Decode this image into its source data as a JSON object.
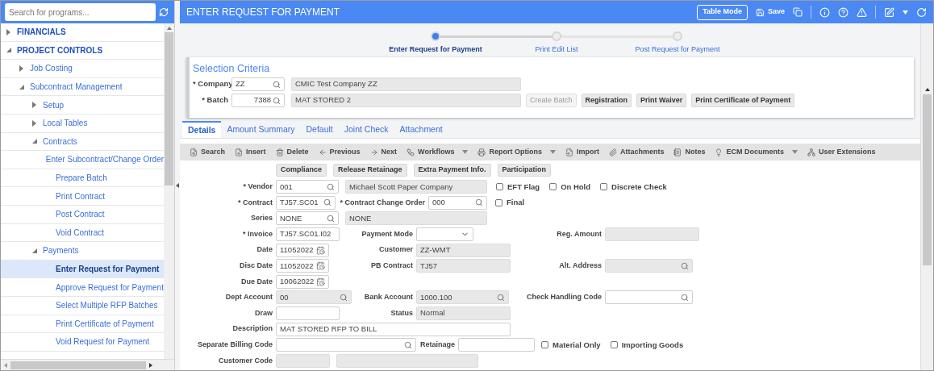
{
  "sidebar": {
    "search": {
      "placeholder": "Search for programs..."
    },
    "tree": [
      {
        "label": "FINANCIALS",
        "expanded": false,
        "selected": false
      },
      {
        "label": "PROJECT CONTROLS",
        "expanded": true,
        "selected": false,
        "children": [
          {
            "label": "Job Costing",
            "expanded": false,
            "selected": false
          },
          {
            "label": "Subcontract Management",
            "expanded": true,
            "selected": false,
            "children": [
              {
                "label": "Setup",
                "expanded": false,
                "selected": false
              },
              {
                "label": "Local Tables",
                "expanded": false,
                "selected": false
              },
              {
                "label": "Contracts",
                "expanded": true,
                "selected": false,
                "children": [
                  {
                    "label": "Enter Subcontract/Change Order",
                    "selected": false
                  },
                  {
                    "label": "Prepare Batch",
                    "selected": false
                  },
                  {
                    "label": "Print Contract",
                    "selected": false
                  },
                  {
                    "label": "Post Contract",
                    "selected": false
                  },
                  {
                    "label": "Void Contract",
                    "selected": false
                  }
                ]
              },
              {
                "label": "Payments",
                "expanded": true,
                "selected": false,
                "children": [
                  {
                    "label": "Enter Request for Payment",
                    "selected": true
                  },
                  {
                    "label": "Approve Request for Payment",
                    "selected": false
                  },
                  {
                    "label": "Select Multiple RFP Batches",
                    "selected": false
                  },
                  {
                    "label": "Print Certificate of Payment",
                    "selected": false
                  },
                  {
                    "label": "Void Request for Payment",
                    "selected": false
                  }
                ]
              }
            ]
          }
        ]
      }
    ]
  },
  "header": {
    "title": "ENTER REQUEST FOR PAYMENT",
    "table_mode_button": "Table Mode",
    "save_button": "Save"
  },
  "steps": [
    {
      "label": "Enter Request for Payment",
      "selected": true
    },
    {
      "label": "Print Edit List",
      "selected": false
    },
    {
      "label": "Post Request for Payment",
      "selected": false
    }
  ],
  "selection_criteria": {
    "title": "Selection Criteria",
    "rows": [
      {
        "label": "* Company",
        "value": "ZZ",
        "name": "CMIC Test Company ZZ",
        "buttons": []
      },
      {
        "label": "* Batch",
        "value": "7388",
        "name": "MAT STORED 2",
        "buttons": [
          {
            "label": "Create Batch",
            "disabled": true
          },
          {
            "label": "Registration",
            "disabled": false
          },
          {
            "label": "Print Waiver",
            "disabled": false
          },
          {
            "label": "Print Certificate of Payment",
            "disabled": false
          }
        ]
      }
    ]
  },
  "tabs": [
    {
      "label": "Details",
      "selected": true
    },
    {
      "label": "Amount Summary",
      "selected": false
    },
    {
      "label": "Default",
      "selected": false
    },
    {
      "label": "Joint Check",
      "selected": false
    },
    {
      "label": "Attachment",
      "selected": false
    }
  ],
  "toolbar": [
    {
      "label": "Search",
      "dropdown": false
    },
    {
      "label": "Insert",
      "dropdown": false
    },
    {
      "label": "Delete",
      "dropdown": false
    },
    {
      "label": "Previous",
      "dropdown": false
    },
    {
      "label": "Next",
      "dropdown": false
    },
    {
      "label": "Workflows",
      "dropdown": true
    },
    {
      "label": "Report Options",
      "dropdown": true
    },
    {
      "label": "Import",
      "dropdown": false
    },
    {
      "label": "Attachments",
      "dropdown": false
    },
    {
      "label": "Notes",
      "dropdown": false
    },
    {
      "label": "ECM Documents",
      "dropdown": true
    },
    {
      "label": "User Extensions",
      "dropdown": false
    }
  ],
  "action_buttons": [
    "Compliance",
    "Release Retainage",
    "Extra Payment Info.",
    "Participation"
  ],
  "form_rows": [
    [
      {
        "kind": "lookup",
        "label": "* Vendor",
        "value": "001",
        "readonly": false
      },
      {
        "kind": "text",
        "value": "Michael Scott Paper Company",
        "readonly": true
      },
      {
        "kind": "checkbox",
        "label": "EFT Flag",
        "checked": false
      },
      {
        "kind": "checkbox",
        "label": "On Hold",
        "checked": false
      },
      {
        "kind": "checkbox",
        "label": "Discrete Check",
        "checked": false
      }
    ],
    [
      {
        "kind": "lookup",
        "label": "* Contract",
        "value": "TJ57.SC01",
        "readonly": false
      },
      {
        "kind": "lookup",
        "label": "* Contract Change Order",
        "value": "000",
        "readonly": false
      },
      {
        "kind": "checkbox",
        "label": "Final",
        "checked": false
      }
    ],
    [
      {
        "kind": "lookup",
        "label": "Series",
        "value": "NONE",
        "readonly": false
      },
      {
        "kind": "text",
        "value": "NONE",
        "readonly": true
      }
    ],
    [
      {
        "kind": "text",
        "label": "* Invoice",
        "value": "TJ57.SC01.I02",
        "readonly": false
      },
      {
        "kind": "select",
        "label": "Payment Mode",
        "readonly": false
      },
      {
        "kind": "text",
        "label": "Reg. Amount",
        "readonly": true
      }
    ],
    [
      {
        "kind": "date",
        "label": "Date",
        "value": "11052022",
        "readonly": false
      },
      {
        "kind": "text",
        "label": "Customer",
        "value": "ZZ-WMT",
        "readonly": true
      }
    ],
    [
      {
        "kind": "date",
        "label": "Disc Date",
        "value": "11052022",
        "readonly": false
      },
      {
        "kind": "text",
        "label": "PB Contract",
        "value": "TJ57",
        "readonly": true
      },
      {
        "kind": "lookup",
        "label": "Alt. Address",
        "readonly": true
      }
    ],
    [
      {
        "kind": "date",
        "label": "Due Date",
        "value": "10062022",
        "readonly": false
      }
    ],
    [
      {
        "kind": "lookup",
        "label": "Dept Account",
        "value": "00",
        "readonly": true
      },
      {
        "kind": "lookup",
        "label": "Bank Account",
        "value": "1000.100",
        "readonly": true
      },
      {
        "kind": "lookup",
        "label": "Check Handling Code",
        "readonly": false
      }
    ],
    [
      {
        "kind": "text",
        "label": "Draw",
        "readonly": false
      },
      {
        "kind": "text",
        "label": "Status",
        "value": "Normal",
        "readonly": true
      }
    ],
    [
      {
        "kind": "text",
        "label": "Description",
        "value": "MAT STORED RFP TO BILL",
        "readonly": false
      }
    ],
    [
      {
        "kind": "lookup",
        "label": "Separate Billing Code",
        "readonly": false
      },
      {
        "kind": "text",
        "label": "Retainage",
        "readonly": false
      },
      {
        "kind": "checkbox",
        "label": "Material Only",
        "checked": false
      },
      {
        "kind": "checkbox",
        "label": "Importing Goods",
        "checked": false
      }
    ],
    [
      {
        "kind": "text",
        "label": "Customer Code",
        "readonly": true
      },
      {
        "kind": "text",
        "readonly": true
      }
    ]
  ]
}
